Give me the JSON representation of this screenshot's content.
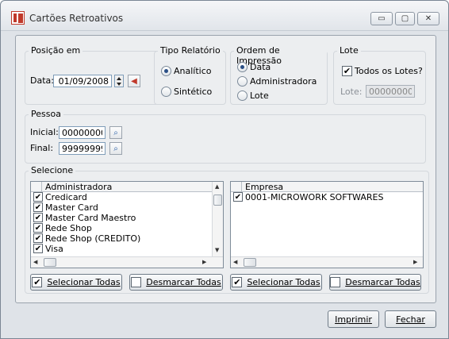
{
  "window": {
    "title": "Cartões Retroativos",
    "minimize_glyph": "▭",
    "maximize_glyph": "▢",
    "close_glyph": "✕"
  },
  "posicao": {
    "legend": "Posição em",
    "data_label": "Data:",
    "data_value": "01/09/2008"
  },
  "tipo": {
    "legend": "Tipo Relatório",
    "options": [
      "Analítico",
      "Sintético"
    ],
    "selected": 0
  },
  "ordem": {
    "legend": "Ordem de Impressão",
    "options": [
      "Data",
      "Administradora",
      "Lote"
    ],
    "selected": 0
  },
  "lote": {
    "legend": "Lote",
    "todos_label": "Todos os Lotes?",
    "todos_checked": true,
    "lote_label": "Lote:",
    "lote_value": "000000000"
  },
  "pessoa": {
    "legend": "Pessoa",
    "inicial_label": "Inicial:",
    "inicial_value": "00000000",
    "final_label": "Final:",
    "final_value": "99999999"
  },
  "selecione": {
    "legend": "Selecione",
    "administradora": {
      "header": "Administradora",
      "items": [
        {
          "label": "Credicard",
          "checked": true
        },
        {
          "label": "Master Card",
          "checked": true
        },
        {
          "label": "Master Card Maestro",
          "checked": true
        },
        {
          "label": "Rede Shop",
          "checked": true
        },
        {
          "label": "Rede Shop (CREDITO)",
          "checked": true
        },
        {
          "label": "Visa",
          "checked": true
        }
      ]
    },
    "empresa": {
      "header": "Empresa",
      "items": [
        {
          "label": "0001-MICROWORK SOFTWARES",
          "checked": true
        }
      ]
    },
    "select_all_label": "Selecionar Todas",
    "deselect_all_label": "Desmarcar Todas"
  },
  "footer": {
    "print_label": "Imprimir",
    "close_label": "Fechar"
  },
  "icons": {
    "check_glyph": "✔",
    "search_glyph": "⌕",
    "calendar_glyph": "◀"
  }
}
